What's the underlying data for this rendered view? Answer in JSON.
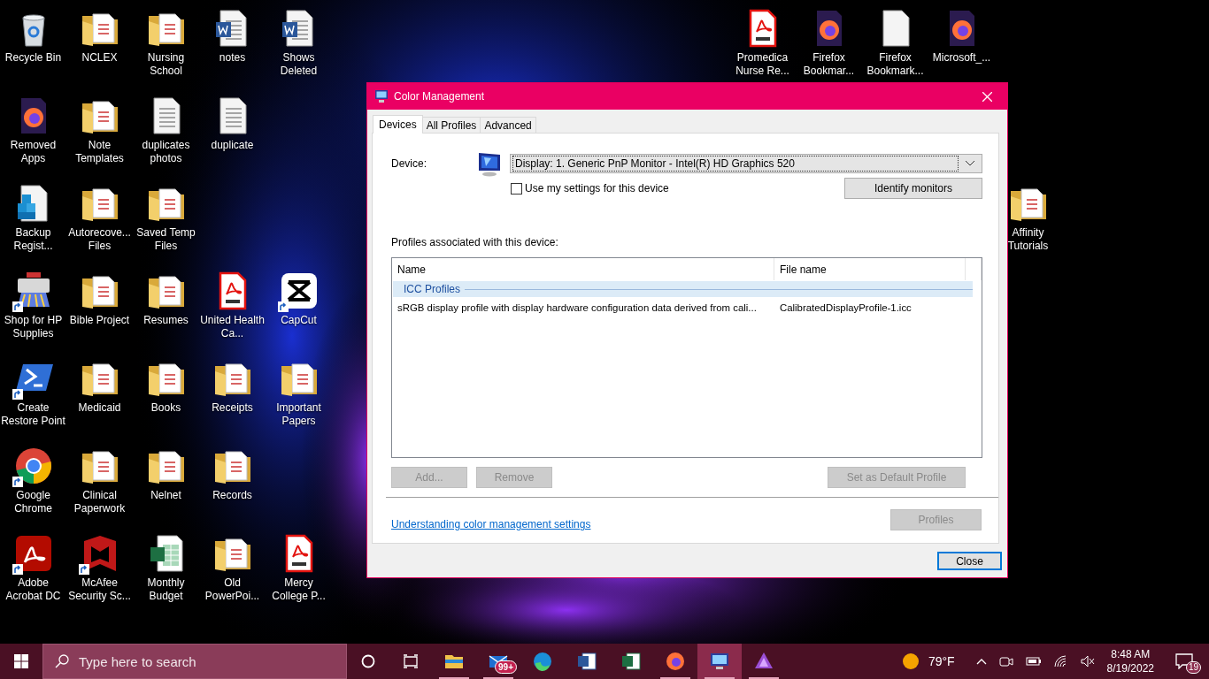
{
  "desktop": {
    "rows": [
      [
        {
          "label": "Recycle Bin",
          "kind": "recycle",
          "shortcut": false
        },
        {
          "label": "NCLEX",
          "kind": "folder",
          "shortcut": false
        },
        {
          "label": "Nursing School",
          "kind": "folder",
          "shortcut": false
        },
        {
          "label": "notes",
          "kind": "word",
          "shortcut": false
        },
        {
          "label": "Shows Deleted",
          "kind": "word",
          "shortcut": false
        }
      ],
      [
        {
          "label": "Removed Apps",
          "kind": "firefox",
          "shortcut": false
        },
        {
          "label": "Note Templates",
          "kind": "folder",
          "shortcut": false
        },
        {
          "label": "duplicates photos",
          "kind": "text",
          "shortcut": false
        },
        {
          "label": "duplicate",
          "kind": "text",
          "shortcut": false
        }
      ],
      [
        {
          "label": "Backup Regist...",
          "kind": "registry",
          "shortcut": false
        },
        {
          "label": "Autorecove... Files",
          "kind": "folder",
          "shortcut": false
        },
        {
          "label": "Saved Temp Files",
          "kind": "folder",
          "shortcut": false
        }
      ],
      [
        {
          "label": "Shop for HP Supplies",
          "kind": "printer",
          "shortcut": true
        },
        {
          "label": "Bible Project",
          "kind": "folder",
          "shortcut": false
        },
        {
          "label": "Resumes",
          "kind": "folder",
          "shortcut": false
        },
        {
          "label": "United Health Ca...",
          "kind": "pdf",
          "shortcut": false
        },
        {
          "label": "CapCut",
          "kind": "capcut",
          "shortcut": true
        }
      ],
      [
        {
          "label": "Create Restore Point",
          "kind": "powershell",
          "shortcut": true
        },
        {
          "label": "Medicaid",
          "kind": "folder",
          "shortcut": false
        },
        {
          "label": "Books",
          "kind": "folder",
          "shortcut": false
        },
        {
          "label": "Receipts",
          "kind": "folder",
          "shortcut": false
        },
        {
          "label": "Important Papers",
          "kind": "folder",
          "shortcut": false
        }
      ],
      [
        {
          "label": "Google Chrome",
          "kind": "chrome",
          "shortcut": true
        },
        {
          "label": "Clinical Paperwork",
          "kind": "folder",
          "shortcut": false
        },
        {
          "label": "Nelnet",
          "kind": "folder",
          "shortcut": false
        },
        {
          "label": "Records",
          "kind": "folder",
          "shortcut": false
        }
      ],
      [
        {
          "label": "Adobe Acrobat DC",
          "kind": "acrobat",
          "shortcut": true
        },
        {
          "label": "McAfee Security Sc...",
          "kind": "mcafee",
          "shortcut": true
        },
        {
          "label": "Monthly Budget",
          "kind": "excel",
          "shortcut": false
        },
        {
          "label": "Old PowerPoi...",
          "kind": "folder",
          "shortcut": false
        },
        {
          "label": "Mercy College P...",
          "kind": "pdf",
          "shortcut": false
        }
      ]
    ],
    "top_right": [
      {
        "label": "Promedica Nurse Re...",
        "kind": "pdf",
        "shortcut": false
      },
      {
        "label": "Firefox Bookmar...",
        "kind": "firefox",
        "shortcut": false
      },
      {
        "label": "Firefox Bookmark...",
        "kind": "blank",
        "shortcut": false
      },
      {
        "label": "Microsoft_...",
        "kind": "firefox",
        "shortcut": false
      }
    ],
    "side": [
      {
        "label": "Affinity Tutorials",
        "kind": "folder",
        "shortcut": false
      }
    ]
  },
  "dialog": {
    "title": "Color Management",
    "tabs": [
      {
        "label": "Devices",
        "selected": true
      },
      {
        "label": "All Profiles",
        "selected": false
      },
      {
        "label": "Advanced",
        "selected": false
      }
    ],
    "device_label": "Device:",
    "device_value": "Display: 1. Generic PnP Monitor - Intel(R) HD Graphics 520",
    "use_my_settings": {
      "label": "Use my settings for this device",
      "checked": false
    },
    "identify_button": "Identify monitors",
    "profiles_label": "Profiles associated with this device:",
    "table": {
      "columns": [
        "Name",
        "File name"
      ],
      "group": "ICC Profiles",
      "rows": [
        {
          "name": "sRGB display profile with display hardware configuration data derived from cali...",
          "file_name": "CalibratedDisplayProfile-1.icc"
        }
      ]
    },
    "buttons": [
      {
        "label": "Add...",
        "disabled": true
      },
      {
        "label": "Remove",
        "disabled": true
      },
      {
        "label": "Set as Default Profile",
        "disabled": true
      }
    ],
    "link": "Understanding color management settings",
    "profiles_button": {
      "label": "Profiles",
      "disabled": true
    },
    "close_button": "Close"
  },
  "taskbar": {
    "search_placeholder": "Type here to search",
    "apps": [
      {
        "kind": "explorer",
        "running": true,
        "selected": false
      },
      {
        "kind": "mail",
        "running": true,
        "selected": false,
        "badge": "99+"
      },
      {
        "kind": "edge",
        "running": false,
        "selected": false
      },
      {
        "kind": "word",
        "running": false,
        "selected": false
      },
      {
        "kind": "excel",
        "running": false,
        "selected": false
      },
      {
        "kind": "firefox",
        "running": true,
        "selected": false
      },
      {
        "kind": "colormgmt",
        "running": true,
        "selected": true
      },
      {
        "kind": "affinity",
        "running": true,
        "selected": false
      }
    ],
    "temperature": "79°F",
    "time": "8:48 AM",
    "date": "8/19/2022",
    "notifications": "19"
  }
}
